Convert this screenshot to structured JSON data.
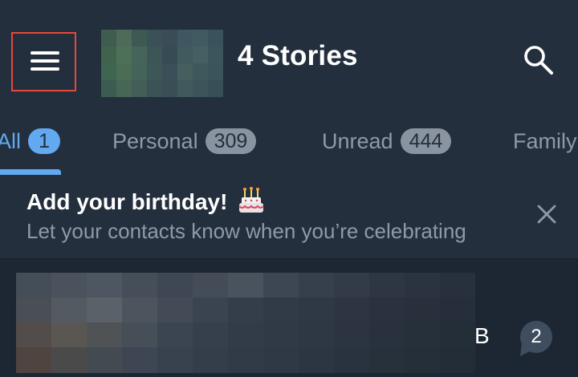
{
  "header": {
    "title": "4 Stories"
  },
  "tabs": [
    {
      "label": "All",
      "badge": "1",
      "active": true
    },
    {
      "label": "Personal",
      "badge": "309"
    },
    {
      "label": "Unread",
      "badge": "444"
    },
    {
      "label": "Family",
      "badge": ""
    }
  ],
  "banner": {
    "title": "Add your birthday!",
    "subtitle": "Let your contacts know when you’re celebrating"
  },
  "chat": {
    "trailing_letter": "B",
    "unread_count": "2"
  },
  "colors": {
    "accent": "#62a9f0",
    "highlight_box": "#e5483d",
    "header_bg": "#242f3d",
    "list_bg": "#1d2733"
  },
  "icons": [
    "menu-icon",
    "search-icon",
    "cake-icon",
    "close-icon"
  ]
}
